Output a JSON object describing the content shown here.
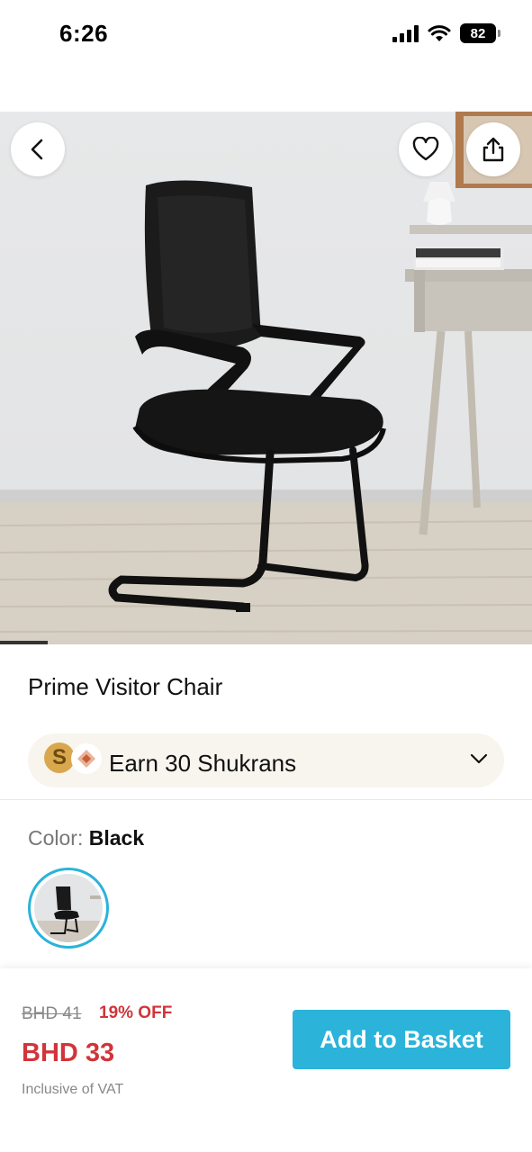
{
  "status_bar": {
    "time": "6:26",
    "battery": "82",
    "icons": [
      "signal-icon",
      "wifi-icon",
      "battery-icon"
    ]
  },
  "hero": {
    "icons": {
      "back": "chevron-left-icon",
      "wishlist": "heart-icon",
      "share": "share-icon"
    },
    "gallery_progress": 0.09
  },
  "product": {
    "title": "Prime Visitor Chair"
  },
  "shukran": {
    "text": "Earn 30 Shukrans",
    "coin_letter": "S",
    "icons": [
      "shukran-coin-icon",
      "diamond-icon",
      "chevron-down-icon"
    ]
  },
  "color": {
    "label": "Color:",
    "value": "Black"
  },
  "pricing": {
    "old_price": "BHD 41",
    "discount": "19% OFF",
    "price": "BHD 33",
    "vat_note": "Inclusive of VAT"
  },
  "cta": {
    "add_to_basket": "Add to Basket"
  },
  "colors": {
    "accent": "#2bb3d9",
    "sale": "#d1343a",
    "shukran_bg": "#f8f5ef"
  }
}
